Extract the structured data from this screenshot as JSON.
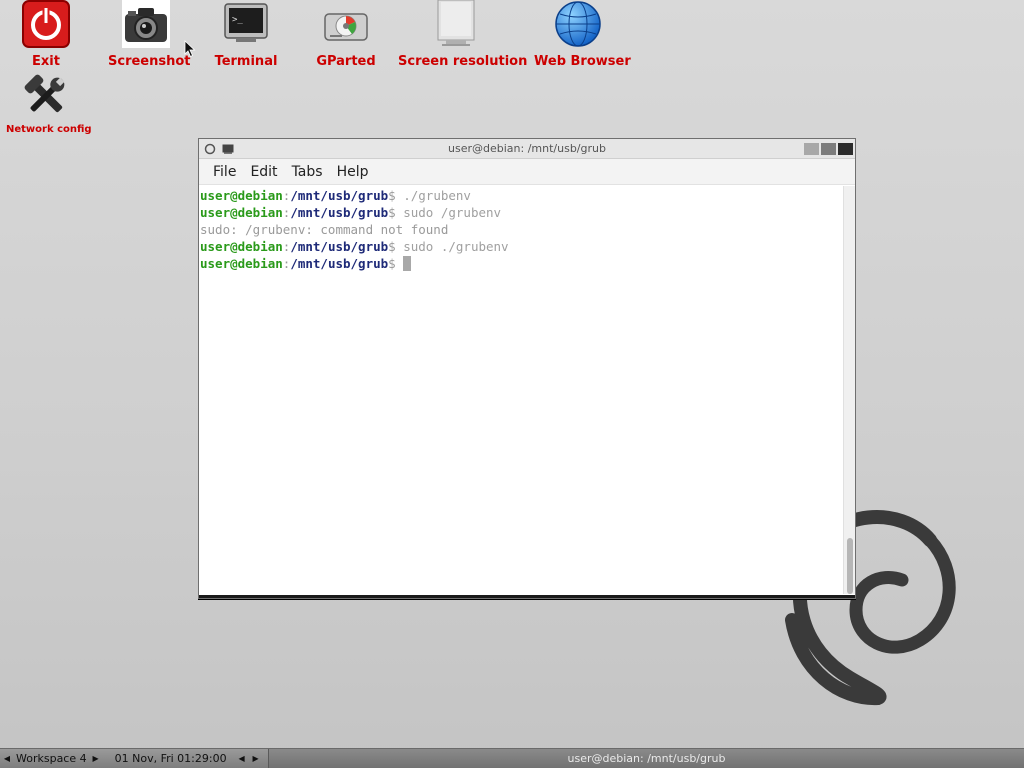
{
  "desktop": {
    "icons": [
      {
        "label": "Exit",
        "icon": "power-icon"
      },
      {
        "label": "Screenshot",
        "icon": "camera-icon"
      },
      {
        "label": "Terminal",
        "icon": "terminal-icon"
      },
      {
        "label": "GParted",
        "icon": "disk-icon"
      },
      {
        "label": "Screen resolution",
        "icon": "monitor-icon"
      },
      {
        "label": "Web Browser",
        "icon": "globe-icon"
      },
      {
        "label": "Network config",
        "icon": "tools-icon"
      }
    ]
  },
  "window": {
    "title": "user@debian: /mnt/usb/grub",
    "menu": [
      "File",
      "Edit",
      "Tabs",
      "Help"
    ]
  },
  "terminal": {
    "user": "user@debian",
    "sep": ":",
    "path": "/mnt/usb/grub",
    "dollar": "$",
    "lines": [
      {
        "cmd": " ./grubenv"
      },
      {
        "cmd": " sudo /grubenv"
      },
      {
        "output": "sudo: /grubenv: command not found"
      },
      {
        "cmd": " sudo ./grubenv"
      },
      {
        "cmd": " "
      }
    ]
  },
  "taskbar": {
    "left_arrow": "◀",
    "right_arrow": "▶",
    "workspace": "Workspace 4",
    "clock": "01 Nov, Fri 01:29:00",
    "task": "user@debian: /mnt/usb/grub"
  },
  "colors": {
    "label_red": "#cc0000",
    "prompt_user": "#2a9a1a",
    "prompt_path": "#1e2a78"
  }
}
